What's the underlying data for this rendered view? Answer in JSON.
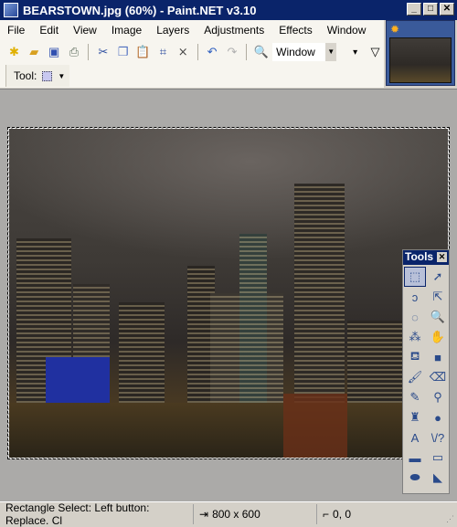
{
  "window": {
    "title": "BEARSTOWN.jpg (60%) - Paint.NET v3.10",
    "minimize": "_",
    "maximize": "□",
    "close": "✕"
  },
  "menu": [
    "File",
    "Edit",
    "View",
    "Image",
    "Layers",
    "Adjustments",
    "Effects",
    "Window"
  ],
  "toolbar": {
    "icons": [
      "new-icon",
      "open-icon",
      "save-icon",
      "print-icon",
      "cut-icon",
      "copy-icon",
      "paste-icon",
      "crop-icon",
      "deselect-icon",
      "undo-icon",
      "redo-icon",
      "zoom-icon"
    ],
    "zoom_value": "Window"
  },
  "toolbar2": {
    "tool_label": "Tool:"
  },
  "tools_window": {
    "title": "Tools",
    "close": "✕",
    "tools": [
      {
        "name": "rectangle-select",
        "glyph": "⬚"
      },
      {
        "name": "move-selected",
        "glyph": "➚"
      },
      {
        "name": "lasso-select",
        "glyph": "ↄ"
      },
      {
        "name": "move-selection",
        "glyph": "⇱"
      },
      {
        "name": "ellipse-select",
        "glyph": "◌"
      },
      {
        "name": "zoom",
        "glyph": "🔍"
      },
      {
        "name": "magic-wand",
        "glyph": "⁂"
      },
      {
        "name": "pan",
        "glyph": "✋"
      },
      {
        "name": "paint-bucket",
        "glyph": "⛾"
      },
      {
        "name": "gradient",
        "glyph": "■"
      },
      {
        "name": "paintbrush",
        "glyph": "🖌"
      },
      {
        "name": "eraser",
        "glyph": "⌫"
      },
      {
        "name": "pencil",
        "glyph": "✎"
      },
      {
        "name": "color-picker",
        "glyph": "⚲"
      },
      {
        "name": "clone-stamp",
        "glyph": "♜"
      },
      {
        "name": "recolor",
        "glyph": "●"
      },
      {
        "name": "text",
        "glyph": "A"
      },
      {
        "name": "line-curve",
        "glyph": "\\/?"
      },
      {
        "name": "rectangle",
        "glyph": "▬"
      },
      {
        "name": "rounded-rectangle",
        "glyph": "▭"
      },
      {
        "name": "ellipse",
        "glyph": "⬬"
      },
      {
        "name": "freeform-shape",
        "glyph": "◣"
      }
    ]
  },
  "status": {
    "hint": "Rectangle Select: Left button: Replace. Cl",
    "image_size": "800 x 600",
    "cursor": "0, 0"
  },
  "colors": {
    "titlebar": "#0a246a",
    "canvas_bg": "#abaaa8"
  }
}
